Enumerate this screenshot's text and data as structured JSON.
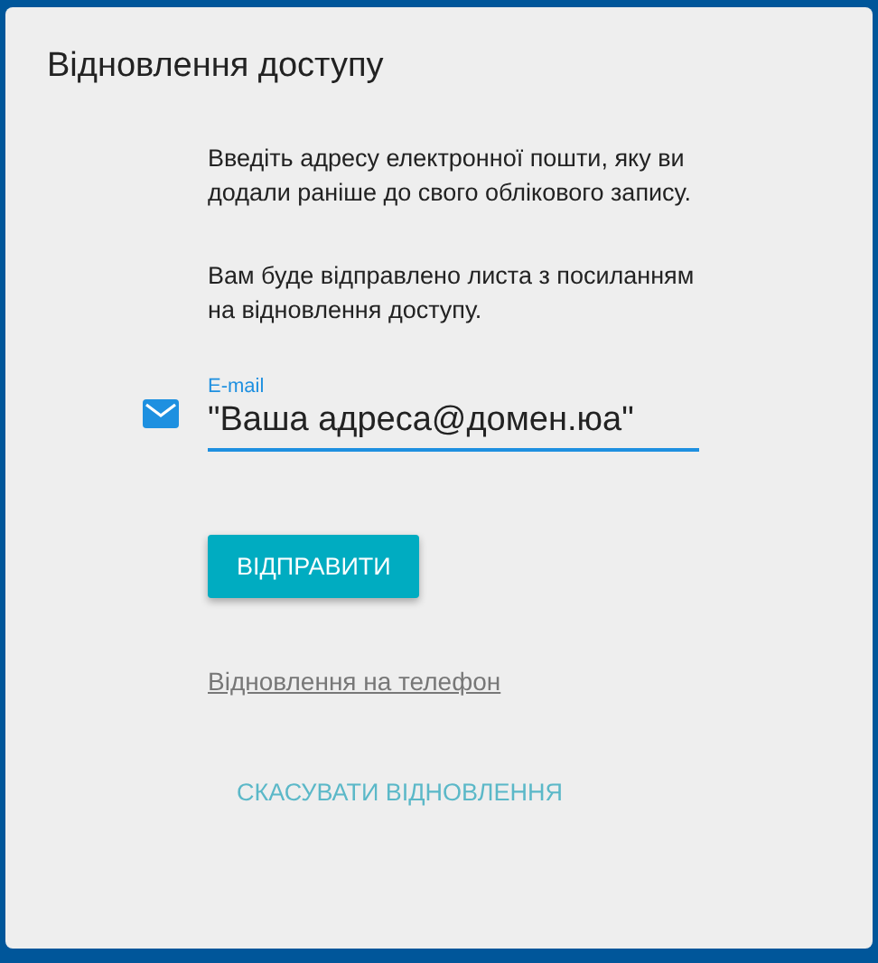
{
  "dialog": {
    "title": "Відновлення доступу",
    "paragraphs": [
      "Введіть адресу електронної пошти, яку ви додали раніше до свого облікового запису.",
      "Вам буде відправлено листа з посиланням на відновлення доступу."
    ],
    "email_field": {
      "label": "E-mail",
      "value": "\"Ваша адреса@домен.юа\"",
      "focused": true
    },
    "submit_button": "ВІДПРАВИТИ",
    "phone_link": "Відновлення на телефон",
    "cancel_button": "СКАСУВАТИ ВІДНОВЛЕННЯ"
  }
}
